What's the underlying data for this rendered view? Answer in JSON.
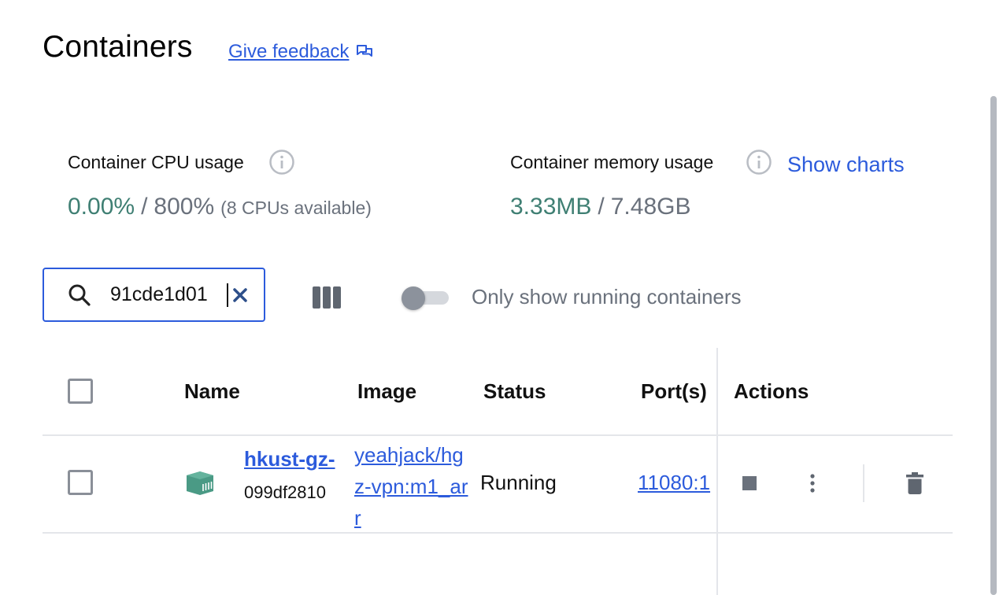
{
  "header": {
    "title": "Containers",
    "feedback_label": "Give feedback",
    "feedback_icon": "feedback-icon"
  },
  "usage": {
    "cpu": {
      "label": "Container CPU usage",
      "value": "0.00%",
      "separator": "/",
      "total": "800%",
      "note": "(8 CPUs available)"
    },
    "memory": {
      "label": "Container memory usage",
      "value": "3.33MB",
      "separator": "/",
      "total": "7.48GB"
    },
    "show_charts_label": "Show charts"
  },
  "toolbar": {
    "search": {
      "value": "91cde1d01",
      "placeholder": ""
    },
    "toggle_label": "Only show running containers",
    "toggle_on": false
  },
  "table": {
    "headers": {
      "name": "Name",
      "image": "Image",
      "status": "Status",
      "ports": "Port(s)",
      "actions": "Actions"
    },
    "rows": [
      {
        "name": "hkust-gz-",
        "id": "099df2810",
        "image": "yeahjack/hgz-vpn:m1_arr",
        "status": "Running",
        "ports": "11080:1"
      }
    ]
  },
  "colors": {
    "accent": "#2c5bdc",
    "usage_value": "#3f7f73",
    "muted": "#6a717c",
    "container_icon": "#4a9a85"
  }
}
